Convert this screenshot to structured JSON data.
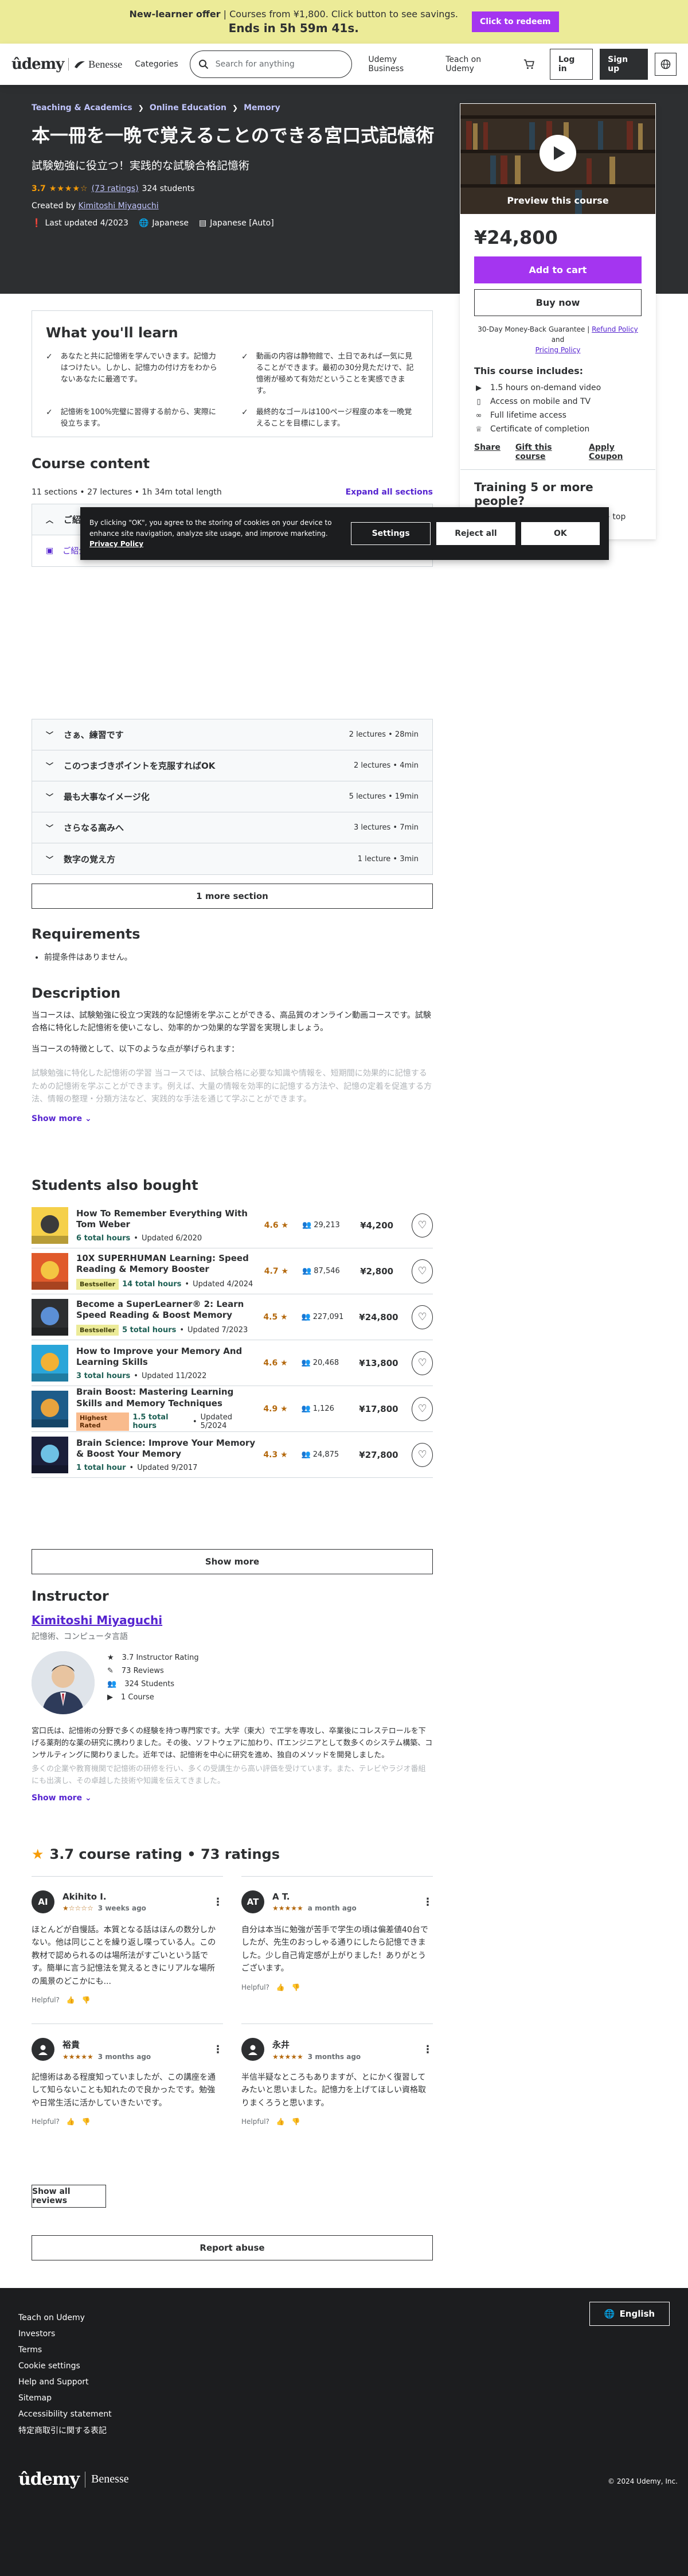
{
  "banner": {
    "bold": "New-learner offer",
    "text": " | Courses from ¥1,800. Click button to see savings.",
    "countdown": "Ends in 5h 59m 41s.",
    "cta": "Click to redeem"
  },
  "header": {
    "logo_udemy": "ûdemy",
    "logo_partner": "Benesse",
    "categories": "Categories",
    "search_placeholder": "Search for anything",
    "business": "Udemy Business",
    "teach": "Teach on Udemy",
    "login": "Log in",
    "signup": "Sign up"
  },
  "hero": {
    "breadcrumbs": [
      "Teaching & Academics",
      "Online Education",
      "Memory"
    ],
    "title": "本一冊を一晩で覚えることのできる宮口式記憶術",
    "subtitle": "試験勉強に役立つ！実践的な試験合格記憶術",
    "rating": "3.7",
    "stars": "★★★★☆",
    "ratings_link": "(73 ratings)",
    "students": "324 students",
    "created_by": "Created by",
    "author": "Kimitoshi Miyaguchi",
    "updated": "Last updated 4/2023",
    "language": "Japanese",
    "captions": "Japanese [Auto]"
  },
  "sidebar": {
    "preview": "Preview this course",
    "price": "¥24,800",
    "add_to_cart": "Add to cart",
    "buy_now": "Buy now",
    "guarantee": "30-Day Money-Back Guarantee |",
    "refund": "Refund Policy",
    "and": "and",
    "pricing": "Pricing Policy",
    "includes_title": "This course includes:",
    "includes": [
      "1.5 hours on-demand video",
      "Access on mobile and TV",
      "Full lifetime access",
      "Certificate of completion"
    ],
    "share": "Share",
    "gift": "Gift this course",
    "coupon": "Apply Coupon",
    "training_title": "Training 5 or more people?",
    "training_desc": "Get your team access to 27,000+ top Udemy"
  },
  "learn": {
    "title": "What you'll learn",
    "items": [
      "あなたと共に記憶術を学んでいきます。記憶力はつけたい。しかし、記憶力の付け方をわからないあなたに最適です。",
      "動画の内容は静物館で、土日であれば一気に見ることができます。最初の30分見ただけで、記憶術が極めて有効だということを実感できます。",
      "記憶術を100%完璧に習得する前から、実際に役立ちます。",
      "最終的なゴールは100ページ程度の本を一晩覚えることを目標にします。"
    ]
  },
  "content": {
    "title": "Course content",
    "meta": "11 sections • 27 lectures • 1h 34m total length",
    "expand": "Expand all sections",
    "first_section": "ご紹介",
    "first_lecture": "ご紹介",
    "sections": [
      {
        "title": "さぁ、練習です",
        "meta": "2 lectures • 28min"
      },
      {
        "title": "このつまづきポイントを克服すればOK",
        "meta": "2 lectures • 4min"
      },
      {
        "title": "最も大事なイメージ化",
        "meta": "5 lectures • 19min"
      },
      {
        "title": "さらなる高みへ",
        "meta": "3 lectures • 7min"
      },
      {
        "title": "数字の覚え方",
        "meta": "1 lecture • 3min"
      }
    ],
    "more": "1 more section"
  },
  "requirements": {
    "title": "Requirements",
    "items": [
      "前提条件はありません。"
    ]
  },
  "description": {
    "title": "Description",
    "p1": "当コースは、試験勉強に役立つ実践的な記憶術を学ぶことができる、高品質のオンライン動画コースです。試験合格に特化した記憶術を使いこなし、効率的かつ効果的な学習を実現しましょう。",
    "p2": "当コースの特徴として、以下のような点が挙げられます：",
    "p3": "試験勉強に特化した記憶術の学習 当コースでは、試験合格に必要な知識や情報を、短期間に効果的に記憶するための記憶術を学ぶことができます。例えば、大量の情報を効率的に記憶する方法や、記憶の定着を促進する方法、情報の整理・分類方法など、実践的な手法を通じて学ぶことができます。",
    "show_more": "Show more"
  },
  "also_bought": {
    "title": "Students also bought",
    "courses": [
      {
        "title": "How To Remember Everything With Tom Weber",
        "badge": "",
        "hours": "6 total hours",
        "updated": "Updated 6/2020",
        "rating": "4.6 ★",
        "students": "29,213",
        "price": "¥4,200"
      },
      {
        "title": "10X SUPERHUMAN Learning: Speed Reading & Memory Booster",
        "badge": "Bestseller",
        "hours": "14 total hours",
        "updated": "Updated 4/2024",
        "rating": "4.7 ★",
        "students": "87,546",
        "price": "¥2,800"
      },
      {
        "title": "Become a SuperLearner® 2: Learn Speed Reading & Boost Memory",
        "badge": "Bestseller",
        "hours": "5 total hours",
        "updated": "Updated 7/2023",
        "rating": "4.5 ★",
        "students": "227,091",
        "price": "¥24,800"
      },
      {
        "title": "How to Improve your Memory And Learning Skills",
        "badge": "",
        "hours": "3 total hours",
        "updated": "Updated 11/2022",
        "rating": "4.6 ★",
        "students": "20,468",
        "price": "¥13,800"
      },
      {
        "title": "Brain Boost: Mastering Learning Skills and Memory Techniques",
        "badge": "Highest Rated",
        "hours": "1.5 total hours",
        "updated": "Updated 5/2024",
        "rating": "4.9 ★",
        "students": "1,126",
        "price": "¥17,800"
      },
      {
        "title": "Brain Science: Improve Your Memory & Boost Your Memory",
        "badge": "",
        "hours": "1 total hour",
        "updated": "Updated 9/2017",
        "rating": "4.3 ★",
        "students": "24,875",
        "price": "¥27,800"
      }
    ],
    "show_more": "Show more"
  },
  "instructor": {
    "title": "Instructor",
    "name": "Kimitoshi Miyaguchi",
    "role": "記憶術、コンピュータ言語",
    "stats": [
      {
        "icon": "★",
        "label": "3.7 Instructor Rating"
      },
      {
        "icon": "✎",
        "label": "73 Reviews"
      },
      {
        "icon": "👥",
        "label": "324 Students"
      },
      {
        "icon": "▶",
        "label": "1 Course"
      }
    ],
    "bio": "宮口氏は、記憶術の分野で多くの経験を持つ専門家です。大学（東大）で工学を専攻し、卒業後にコレステロールを下げる薬剤的な薬の研究に携わりました。その後、ソフトウェアに加わり、ITエンジニアとして数多くのシステム構築、コンサルティングに関わりました。近年では、記憶術を中心に研究を進め、独自のメソッドを開発しました。",
    "bio2": "多くの企業や教育機関で記憶術の研修を行い、多くの受講生から高い評価を受けています。また、テレビやラジオ番組にも出演し、その卓越した技術や知識を伝えてきました。",
    "show_more": "Show more"
  },
  "ratings": {
    "star": "★",
    "title": "3.7 course rating • 73 ratings",
    "helpful": "Helpful?",
    "reviews": [
      {
        "initials": "AI",
        "name": "Akihito I.",
        "stars": "★☆☆☆☆",
        "ago": "3 weeks ago",
        "text": "ほとんどが自慢話。本質となる話はほんの数分しかない。他は同じことを繰り返し喋っている人。この教材で認められるのは場所法がすごいという話です。簡単に言う記憶法を覚えるときにリアルな場所の風景のどこかにも..."
      },
      {
        "initials": "AT",
        "name": "A T.",
        "stars": "★★★★★",
        "ago": "a month ago",
        "text": "自分は本当に勉強が苦手で学生の頃は偏差値40台でしたが、先生のおっしゃる通りにしたら記憶できました。少し自己肯定感が上がりました！ありがとうございます。"
      },
      {
        "initials": "",
        "name": "裕貴",
        "stars": "★★★★★",
        "ago": "3 months ago",
        "text": "記憶術はある程度知っていましたが、この講座を通して知らないことも知れたので良かったです。勉強や日常生活に活かしていきたいです。"
      },
      {
        "initials": "",
        "name": "永井",
        "stars": "★★★★★",
        "ago": "3 months ago",
        "text": "半信半疑なところもありますが、とにかく復習してみたいと思いました。記憶力を上げてほしい資格取りまくろうと思います。"
      }
    ],
    "show_all": "Show all reviews",
    "report": "Report abuse"
  },
  "footer": {
    "links": [
      "Teach on Udemy",
      "Investors",
      "Terms",
      "Cookie settings",
      "Help and Support",
      "Sitemap",
      "Accessibility statement",
      "特定商取引に関する表記"
    ],
    "language": "English",
    "logo_udemy": "ûdemy",
    "logo_partner": "Benesse",
    "copyright": "© 2024 Udemy, Inc."
  },
  "cookie": {
    "text": "By clicking \"OK\", you agree to the storing of cookies on your device to enhance site navigation, analyze site usage, and improve marketing.",
    "link": "Privacy Policy",
    "settings": "Settings",
    "reject": "Reject all",
    "ok": "OK"
  }
}
